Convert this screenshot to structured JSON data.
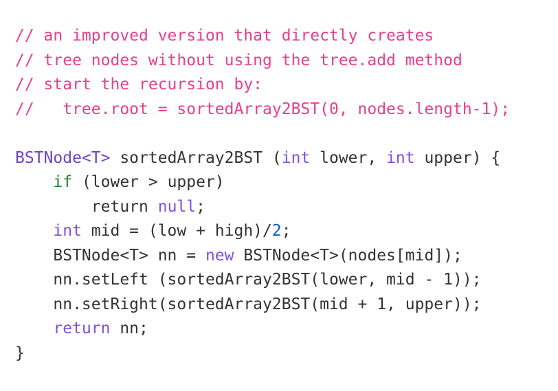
{
  "colors": {
    "comment": "#e83e8c",
    "type": "#6f42c1",
    "keyword_if": "#22863a",
    "keyword": "#8250df",
    "number": "#005cc5",
    "plain": "#333333",
    "background": "#ffffff"
  },
  "code": {
    "l1": "// an improved version that directly creates",
    "l2": "// tree nodes without using the tree.add method",
    "l3": "// start the recursion by:",
    "l4": "//   tree.root = sortedArray2BST(0, nodes.length-1);",
    "l6_type": "BSTNode<T>",
    "l6_a": " sortedArray2BST (",
    "l6_int1": "int",
    "l6_b": " lower, ",
    "l6_int2": "int",
    "l6_c": " upper) {",
    "l7_indent": "    ",
    "l7_if": "if",
    "l7_rest": " (lower > upper)",
    "l8_indent": "        ",
    "l8_return": "return",
    "l8_sp": " ",
    "l8_null": "null",
    "l8_end": ";",
    "l9_indent": "    ",
    "l9_int": "int",
    "l9_a": " mid = (low + high)/",
    "l9_num": "2",
    "l9_end": ";",
    "l10_indent": "    ",
    "l10_a": "BSTNode<T> nn = ",
    "l10_new": "new",
    "l10_b": " BSTNode<T>(nodes[mid]);",
    "l11": "    nn.setLeft (sortedArray2BST(lower, mid - 1));",
    "l12": "    nn.setRight(sortedArray2BST(mid + 1, upper));",
    "l13_indent": "    ",
    "l13_return": "return",
    "l13_rest": " nn;",
    "l14": "}"
  }
}
